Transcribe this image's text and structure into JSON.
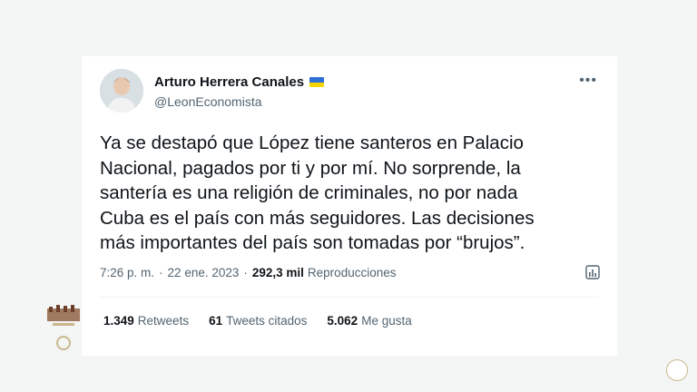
{
  "tweet": {
    "author_name": "Arturo Herrera Canales",
    "handle": "@LeonEconomista",
    "text": "Ya se destapó que López tiene santeros en Palacio\nNacional, pagados por ti y por mí. No sorprende, la\nsantería es una religión de criminales, no por nada\nCuba es el país con más seguidores. Las decisiones\nmás importantes del país son tomadas por “brujos”.",
    "time": "7:26 p. m.",
    "date": "22 ene. 2023",
    "views_count": "292,3 mil",
    "views_label": "Reproducciones",
    "more_label": "•••"
  },
  "stats": [
    {
      "count": "1.349",
      "label": "Retweets"
    },
    {
      "count": "61",
      "label": "Tweets citados"
    },
    {
      "count": "5.062",
      "label": "Me gusta"
    }
  ],
  "colors": {
    "flag_top": "#2f6fd6",
    "flag_bottom": "#f5d400",
    "muted_text": "#536471",
    "background": "#f4f5f5"
  },
  "icons": {
    "analytics": "analytics-icon",
    "more": "more-icon"
  }
}
